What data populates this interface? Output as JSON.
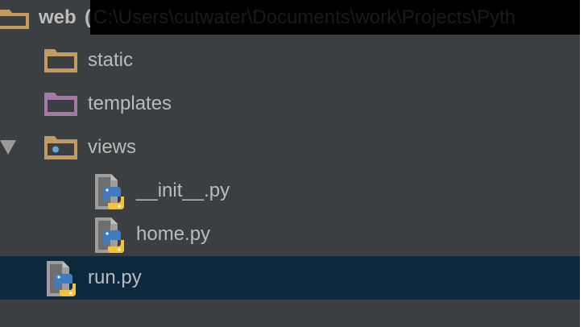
{
  "project_tree": {
    "root": {
      "label": "web",
      "path_prefix": "(",
      "path_text": "C:\\Users\\cutwater\\Documents\\work\\Projects\\Pyth",
      "icon": "folder-icon"
    },
    "items": [
      {
        "label": "static",
        "icon": "folder-icon",
        "icon_color": "#c69a5c"
      },
      {
        "label": "templates",
        "icon": "folder-icon",
        "icon_color": "#a578a8"
      },
      {
        "label": "views",
        "icon": "package-folder-icon",
        "icon_color": "#c69a5c",
        "expanded": true
      },
      {
        "label": "__init__.py",
        "icon": "python-file-icon"
      },
      {
        "label": "home.py",
        "icon": "python-file-icon"
      },
      {
        "label": "run.py",
        "icon": "python-file-icon",
        "selected": true
      }
    ]
  },
  "colors": {
    "panel_bg": "#3c3f41",
    "selection_bg": "#0d293e",
    "text": "#bbbbbb",
    "folder": "#c69a5c",
    "templates_folder": "#a578a8",
    "python_blue": "#3f7bbd",
    "python_yellow": "#f3c33e"
  }
}
